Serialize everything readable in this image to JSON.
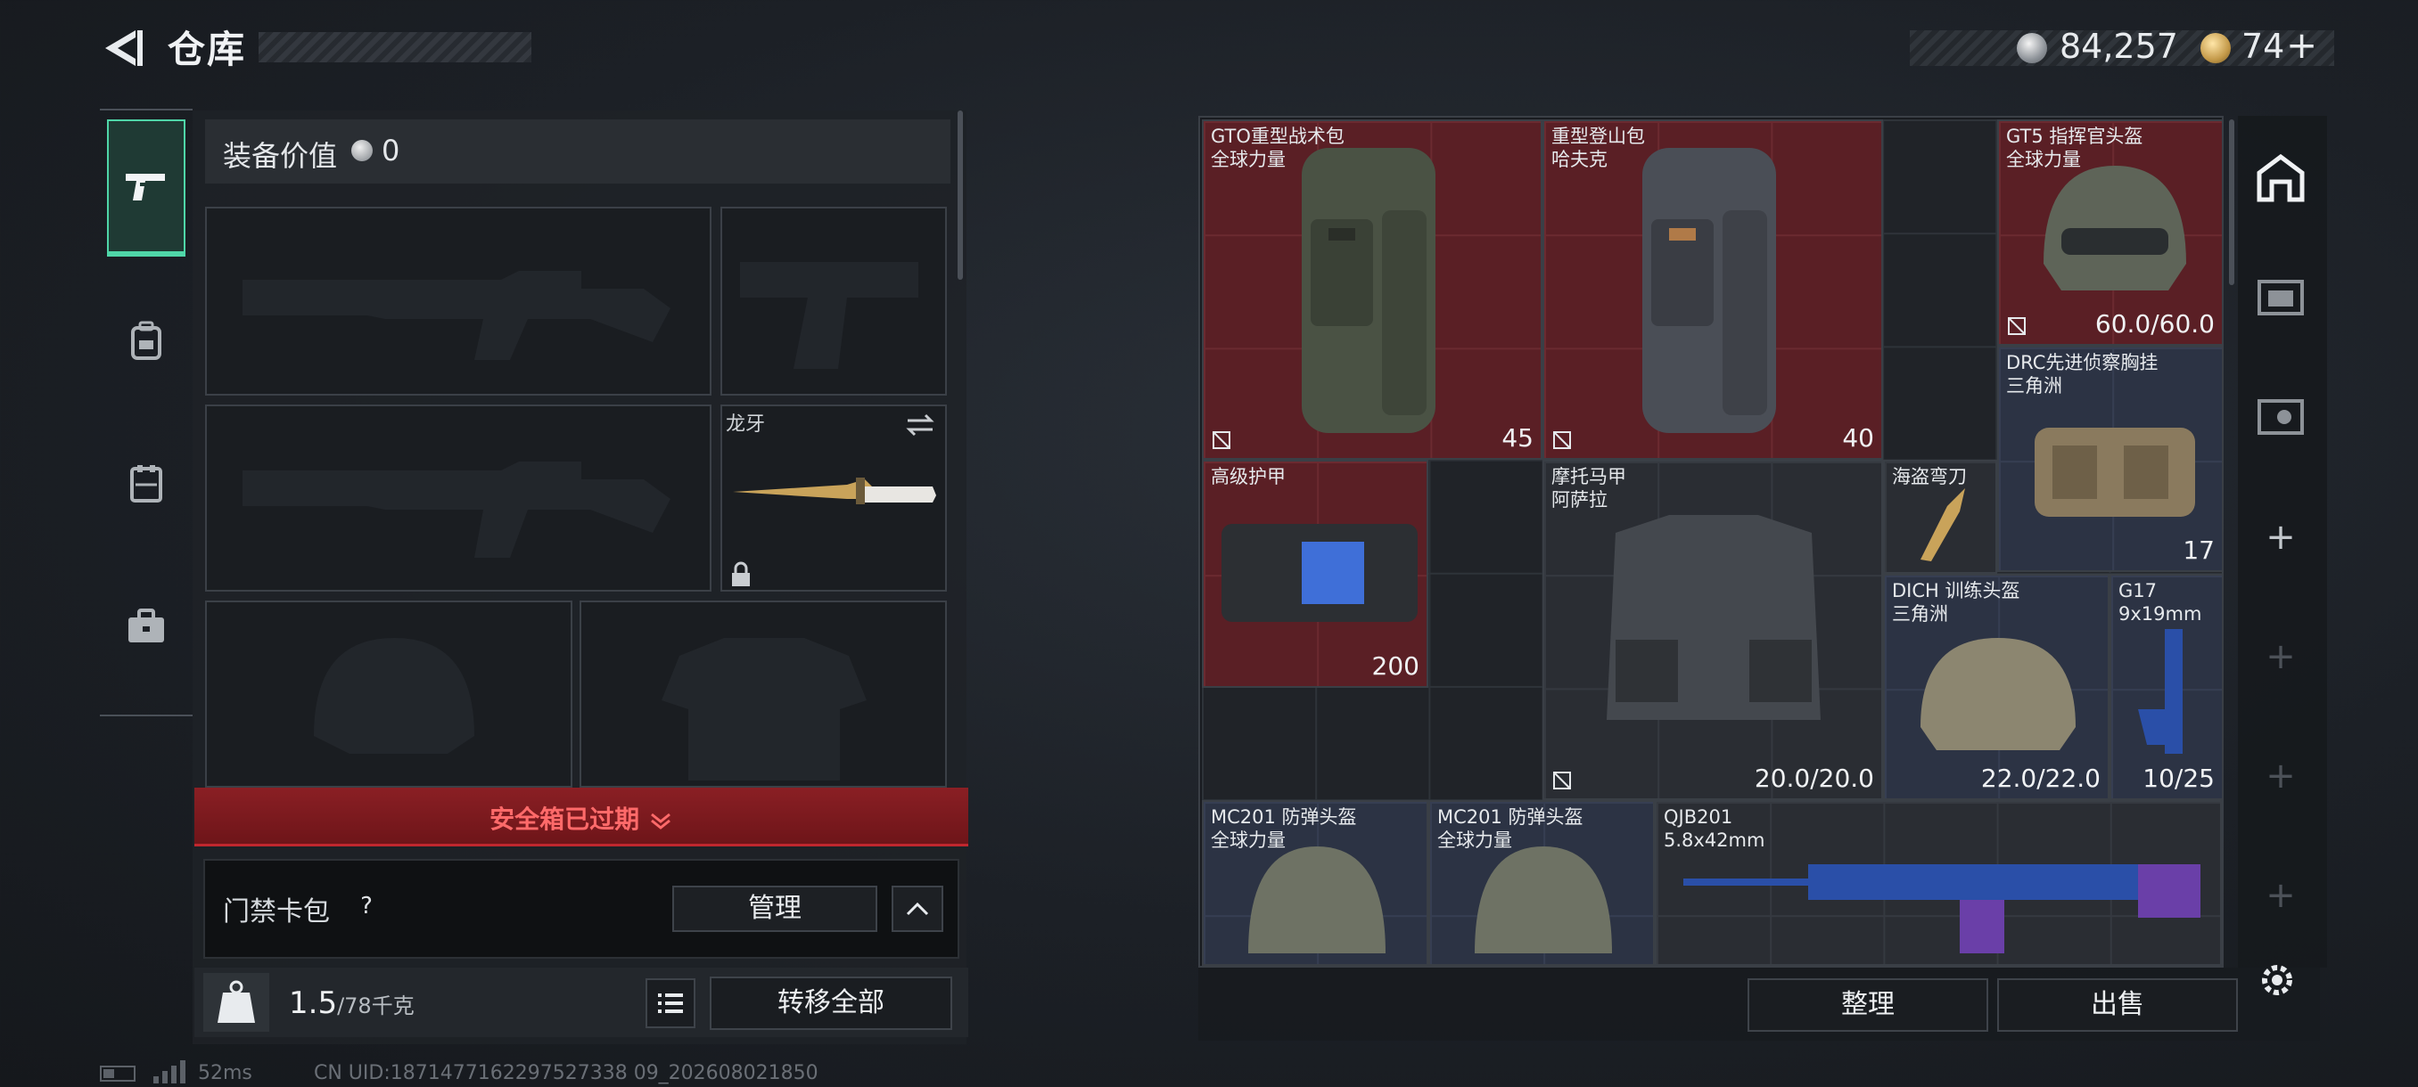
{
  "header": {
    "title": "仓库",
    "currency_silver": "84,257",
    "currency_gold": "74",
    "gold_plus": "+"
  },
  "equipment": {
    "value_label": "装备价值",
    "value_amount": "0",
    "melee_name": "龙牙",
    "safebox_text": "安全箱已过期"
  },
  "keycard": {
    "label": "门禁卡包",
    "help": "?",
    "manage_label": "管理"
  },
  "weight": {
    "current": "1.5",
    "max": "/78千克",
    "transfer_all_label": "转移全部"
  },
  "status": {
    "ping": "52ms",
    "uid": "CN UID:1871477162297527338 09_202608021850"
  },
  "storage": {
    "items": [
      {
        "name": "GTO重型战术包",
        "sub": "全球力量",
        "value": "45"
      },
      {
        "name": "重型登山包",
        "sub": "哈夫克",
        "value": "40"
      },
      {
        "name": "GT5 指挥官头盔",
        "sub": "全球力量",
        "value": "60.0/60.0"
      },
      {
        "name": "DRC先进侦察胸挂",
        "sub": "三角洲",
        "value": "17"
      },
      {
        "name": "高级护甲",
        "sub": "",
        "value": "200"
      },
      {
        "name": "摩托马甲",
        "sub": "阿萨拉",
        "value": "20.0/20.0"
      },
      {
        "name": "海盗弯刀",
        "sub": "",
        "value": ""
      },
      {
        "name": "DICH 训练头盔",
        "sub": "三角洲",
        "value": "22.0/22.0"
      },
      {
        "name": "G17",
        "sub": "9x19mm",
        "value": "10/25"
      },
      {
        "name": "MC201 防弹头盔",
        "sub": "全球力量",
        "value": ""
      },
      {
        "name": "MC201 防弹头盔",
        "sub": "全球力量",
        "value": ""
      },
      {
        "name": "QJB201",
        "sub": "5.8x42mm",
        "value": ""
      }
    ],
    "sort_label": "整理",
    "sell_label": "出售"
  },
  "right_rail": {
    "plus": "+"
  },
  "colors": {
    "accent": "#4fd6a8",
    "danger": "#c0272e",
    "item_red": "#5a1f25",
    "item_blue": "#2c3344"
  }
}
